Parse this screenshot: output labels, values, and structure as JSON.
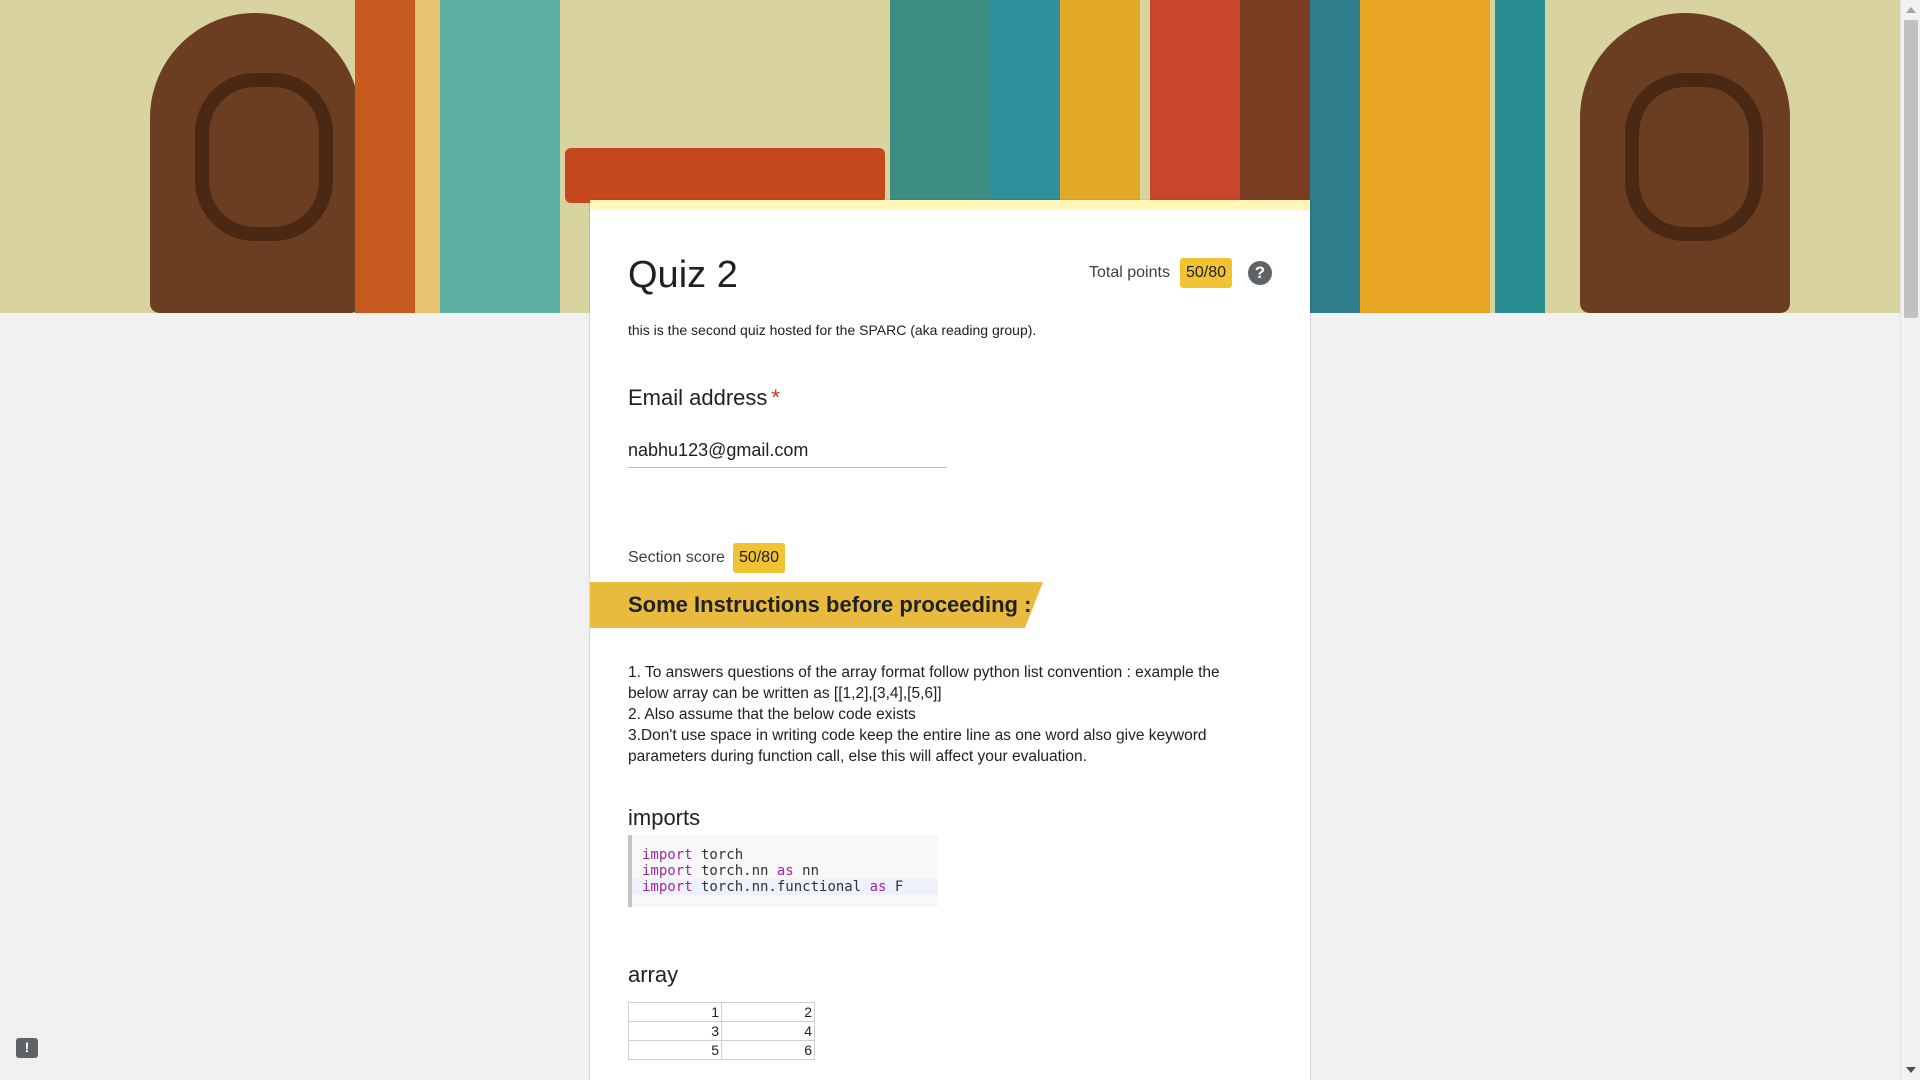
{
  "form": {
    "title": "Quiz 2",
    "total_points_label": "Total points",
    "total_points_value": "50/80",
    "help_symbol": "?",
    "description": "this is the second quiz hosted for the SPARC (aka reading group).",
    "email": {
      "label": "Email address",
      "required_marker": "*",
      "value": "nabhu123@gmail.com"
    },
    "section_score_label": "Section score",
    "section_score_value": "50/80",
    "section_title": "Some Instructions before proceeding :",
    "instructions": [
      "1. To answers questions of the array format follow python list convention : example the below array can be written as [[1,2],[3,4],[5,6]]",
      "2. Also assume that the below code exists",
      "3.Don't use space in writing code keep the entire line as one word also give keyword parameters during function call, else this will affect your evaluation."
    ],
    "imports_heading": "imports",
    "code": [
      {
        "kw1": "import",
        "mod": " torch",
        "kw2": "",
        "alias": ""
      },
      {
        "kw1": "import",
        "mod": " torch.nn ",
        "kw2": "as",
        "alias": " nn"
      },
      {
        "kw1": "import",
        "mod": " torch.nn.functional ",
        "kw2": "as",
        "alias": " F"
      }
    ],
    "array_heading": "array",
    "array_rows": [
      [
        "1",
        "2"
      ],
      [
        "3",
        "4"
      ],
      [
        "5",
        "6"
      ]
    ]
  },
  "feedback_symbol": "!",
  "colors": {
    "accent": "#f1c232",
    "section_header": "#e8ba3e",
    "required": "#d93025",
    "page_bg": "#f1f1f1"
  }
}
